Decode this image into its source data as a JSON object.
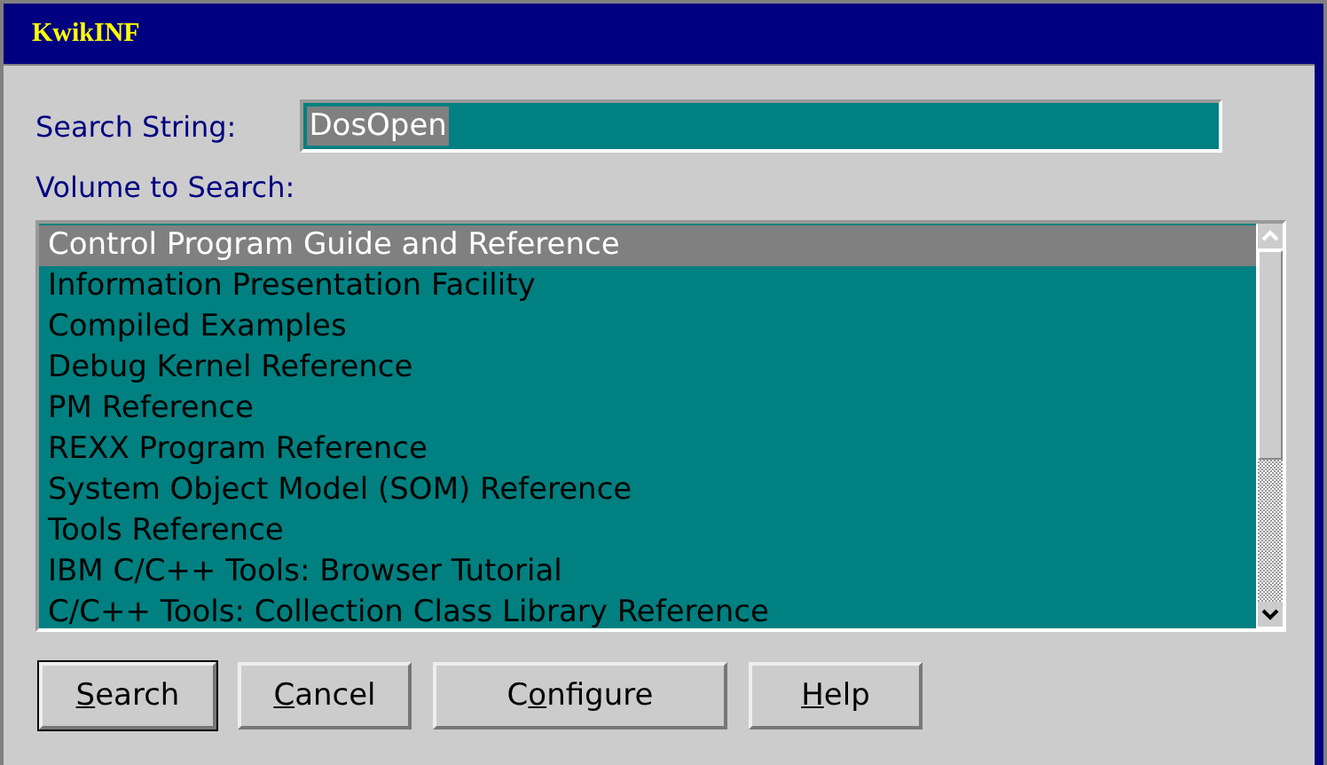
{
  "window": {
    "title": "KwikINF"
  },
  "search_string": {
    "label": "Search String:",
    "value": "DosOpen"
  },
  "volume": {
    "label": "Volume to Search:",
    "items": [
      {
        "label": "Control Program Guide and Reference",
        "selected": true
      },
      {
        "label": "Information Presentation Facility",
        "selected": false
      },
      {
        "label": "Compiled Examples",
        "selected": false
      },
      {
        "label": "Debug Kernel Reference",
        "selected": false
      },
      {
        "label": "PM Reference",
        "selected": false
      },
      {
        "label": "REXX Program Reference",
        "selected": false
      },
      {
        "label": "System Object Model (SOM) Reference",
        "selected": false
      },
      {
        "label": "Tools Reference",
        "selected": false
      },
      {
        "label": "IBM C/C++ Tools: Browser Tutorial",
        "selected": false
      },
      {
        "label": "C/C++ Tools: Collection Class Library Reference",
        "selected": false
      }
    ]
  },
  "buttons": [
    {
      "key": "S",
      "post": "earch",
      "default": true
    },
    {
      "key": "C",
      "post": "ancel",
      "default": false
    },
    {
      "pre": "C",
      "key": "o",
      "post": "nfigure",
      "default": false
    },
    {
      "key": "H",
      "post": "elp",
      "default": false
    }
  ]
}
